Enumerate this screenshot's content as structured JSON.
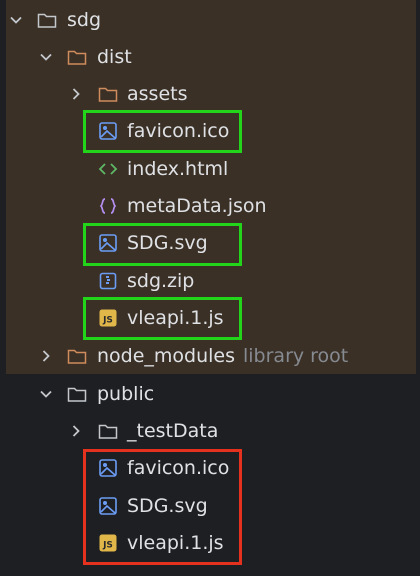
{
  "colors": {
    "background": "#1e1f22",
    "excluded_band": "#3a3026",
    "text": "#dfe1e5",
    "hint_text": "#868a91",
    "highlight_green": "#22d51b",
    "highlight_red": "#e4321f"
  },
  "tree": {
    "root": {
      "label": "sdg",
      "icon": "folder-icon",
      "expanded": true
    },
    "dist": {
      "label": "dist",
      "icon": "folder-icon",
      "expanded": true
    },
    "dist_items": [
      {
        "label": "assets",
        "icon": "folder-icon",
        "expanded": false
      },
      {
        "label": "favicon.ico",
        "icon": "image-icon"
      },
      {
        "label": "index.html",
        "icon": "html-icon"
      },
      {
        "label": "metaData.json",
        "icon": "json-icon"
      },
      {
        "label": "SDG.svg",
        "icon": "image-icon"
      },
      {
        "label": "sdg.zip",
        "icon": "zip-icon"
      },
      {
        "label": "vleapi.1.js",
        "icon": "js-icon"
      }
    ],
    "node_modules": {
      "label": "node_modules",
      "hint": "library root",
      "icon": "folder-icon",
      "expanded": false
    },
    "public": {
      "label": "public",
      "icon": "folder-icon",
      "expanded": true
    },
    "public_items": [
      {
        "label": "_testData",
        "icon": "folder-icon",
        "expanded": false
      },
      {
        "label": "favicon.ico",
        "icon": "image-icon"
      },
      {
        "label": "SDG.svg",
        "icon": "image-icon"
      },
      {
        "label": "vleapi.1.js",
        "icon": "js-icon"
      }
    ],
    "js_badge": "JS"
  }
}
